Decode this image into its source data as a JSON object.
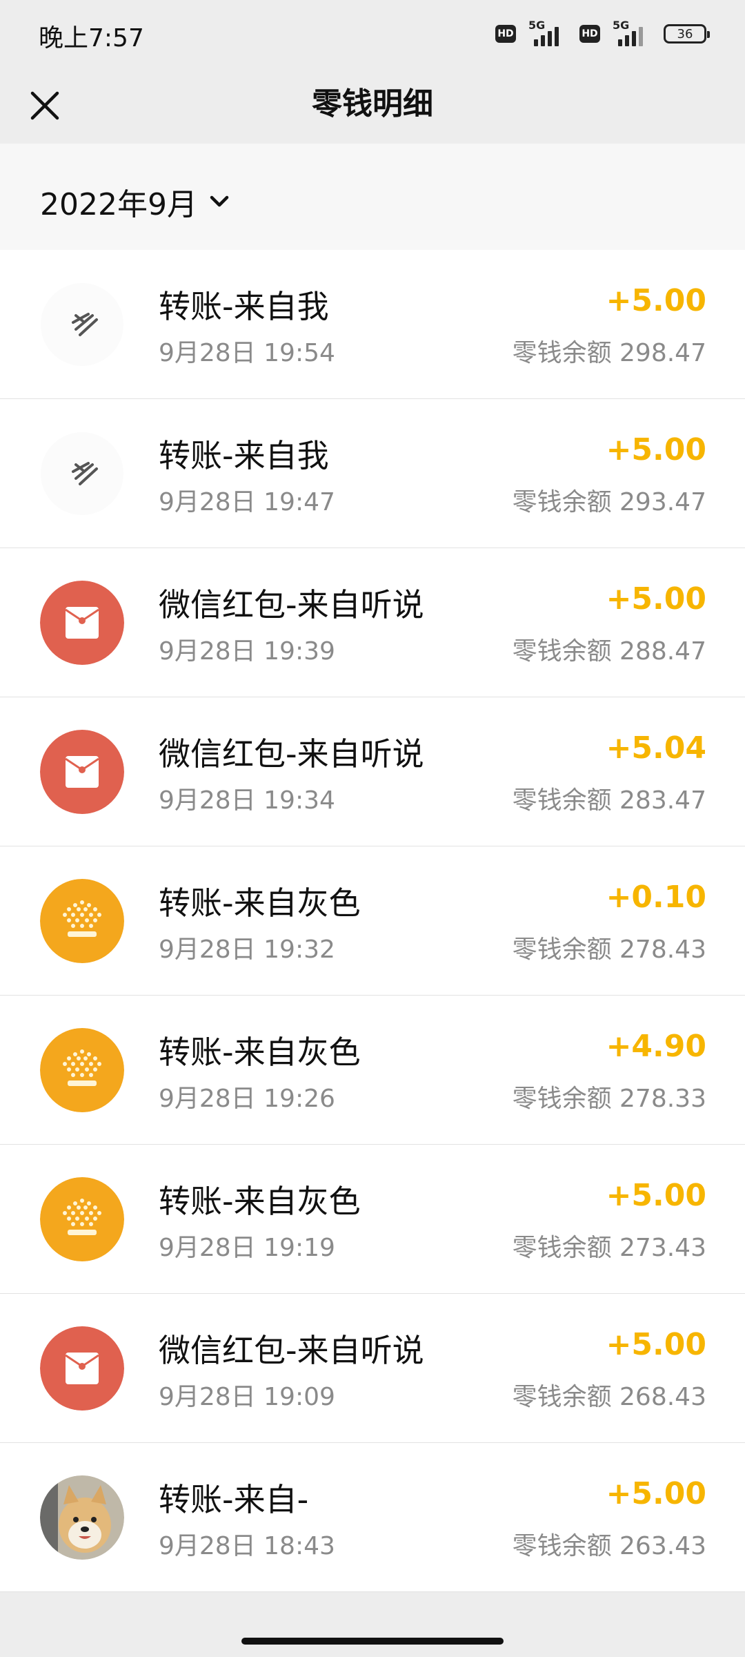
{
  "status_bar": {
    "time": "晚上7:57",
    "hd1": "HD",
    "net1": "5G",
    "hd2": "HD",
    "net2": "5G",
    "battery": "36"
  },
  "nav": {
    "title": "零钱明细",
    "close_icon": "close-icon"
  },
  "filter": {
    "month": "2022年9月",
    "icon": "chevron-down-icon"
  },
  "colors": {
    "amount": "#f7b500",
    "red_packet_bg": "#e0614f",
    "crown_bg": "#f4a71d"
  },
  "transactions": [
    {
      "title": "转账-来自我",
      "time": "9月28日 19:54",
      "amount": "+5.00",
      "balance": "零钱余额 298.47",
      "avatar": "feather-icon"
    },
    {
      "title": "转账-来自我",
      "time": "9月28日 19:47",
      "amount": "+5.00",
      "balance": "零钱余额 293.47",
      "avatar": "feather-icon"
    },
    {
      "title": "微信红包-来自听说",
      "time": "9月28日 19:39",
      "amount": "+5.00",
      "balance": "零钱余额 288.47",
      "avatar": "red-packet-icon"
    },
    {
      "title": "微信红包-来自听说",
      "time": "9月28日 19:34",
      "amount": "+5.04",
      "balance": "零钱余额 283.47",
      "avatar": "red-packet-icon"
    },
    {
      "title": "转账-来自灰色",
      "time": "9月28日 19:32",
      "amount": "+0.10",
      "balance": "零钱余额 278.43",
      "avatar": "crown-icon"
    },
    {
      "title": "转账-来自灰色",
      "time": "9月28日 19:26",
      "amount": "+4.90",
      "balance": "零钱余额 278.33",
      "avatar": "crown-icon"
    },
    {
      "title": "转账-来自灰色",
      "time": "9月28日 19:19",
      "amount": "+5.00",
      "balance": "零钱余额 273.43",
      "avatar": "crown-icon"
    },
    {
      "title": "微信红包-来自听说",
      "time": "9月28日 19:09",
      "amount": "+5.00",
      "balance": "零钱余额 268.43",
      "avatar": "red-packet-icon"
    },
    {
      "title": "转账-来自-",
      "time": "9月28日 18:43",
      "amount": "+5.00",
      "balance": "零钱余额 263.43",
      "avatar": "dog-avatar"
    }
  ]
}
